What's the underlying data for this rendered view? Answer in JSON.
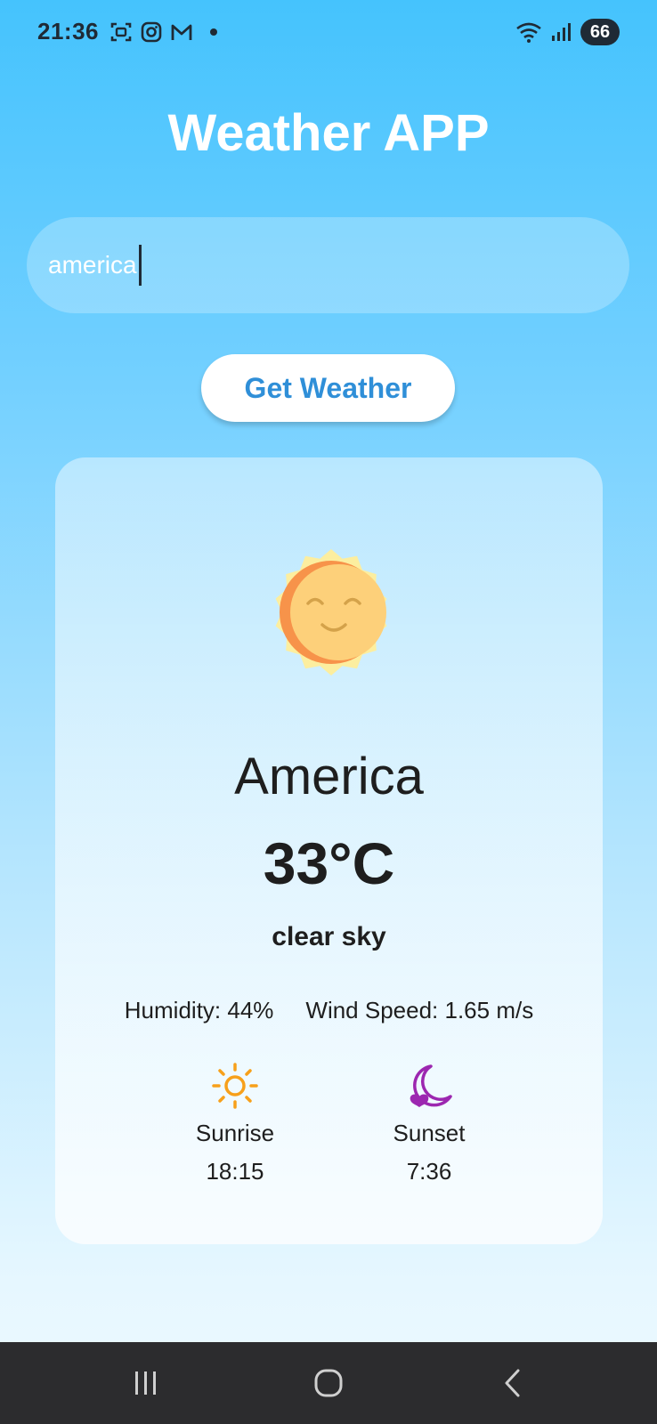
{
  "status_bar": {
    "time": "21:36",
    "battery": "66",
    "left_icons": [
      "screenshot-icon",
      "instagram-icon",
      "gmail-icon",
      "notification-dot"
    ],
    "right_icons": [
      "wifi-icon",
      "signal-icon",
      "battery-icon"
    ]
  },
  "app": {
    "title": "Weather APP"
  },
  "search": {
    "value": "america"
  },
  "actions": {
    "get_weather_label": "Get Weather"
  },
  "weather": {
    "icon": "sun-face-icon",
    "city": "America",
    "temperature": "33°C",
    "description": "clear sky",
    "humidity": "Humidity: 44%",
    "wind_speed": "Wind Speed: 1.65 m/s",
    "sunrise_label": "Sunrise",
    "sunrise_time": "18:15",
    "sunset_label": "Sunset",
    "sunset_time": "7:36"
  },
  "nav_bar": {
    "buttons": [
      "recents-icon",
      "home-icon",
      "back-icon"
    ]
  },
  "colors": {
    "background_top": "#45c3fd",
    "background_bottom": "#eef9ff",
    "button_text": "#2f8fd8",
    "sun_icon_orange": "#f7a01a",
    "moon_icon_purple": "#9c27b0",
    "nav_bar": "#2c2c2e"
  }
}
